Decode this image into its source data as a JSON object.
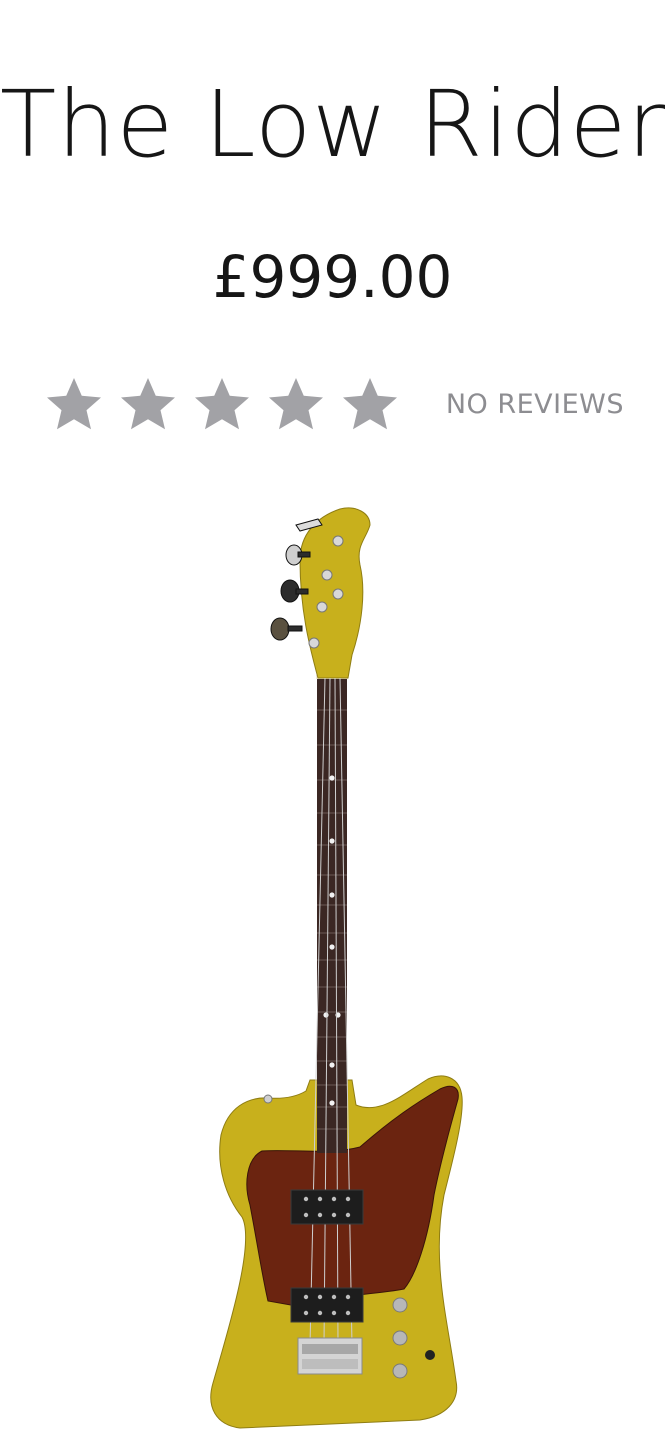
{
  "product": {
    "title": "The Low Rider",
    "price": "£999.00",
    "rating": {
      "stars_filled": 0,
      "stars_total": 5,
      "star_color": "#a2a2a6",
      "reviews_label": "NO REVIEWS",
      "reviews_color": "#8d8d91"
    },
    "image": {
      "subject": "bass-guitar",
      "body_color": "#c8b01c",
      "pickguard_color": "#6b2410",
      "fretboard_color": "#3b2723"
    }
  }
}
